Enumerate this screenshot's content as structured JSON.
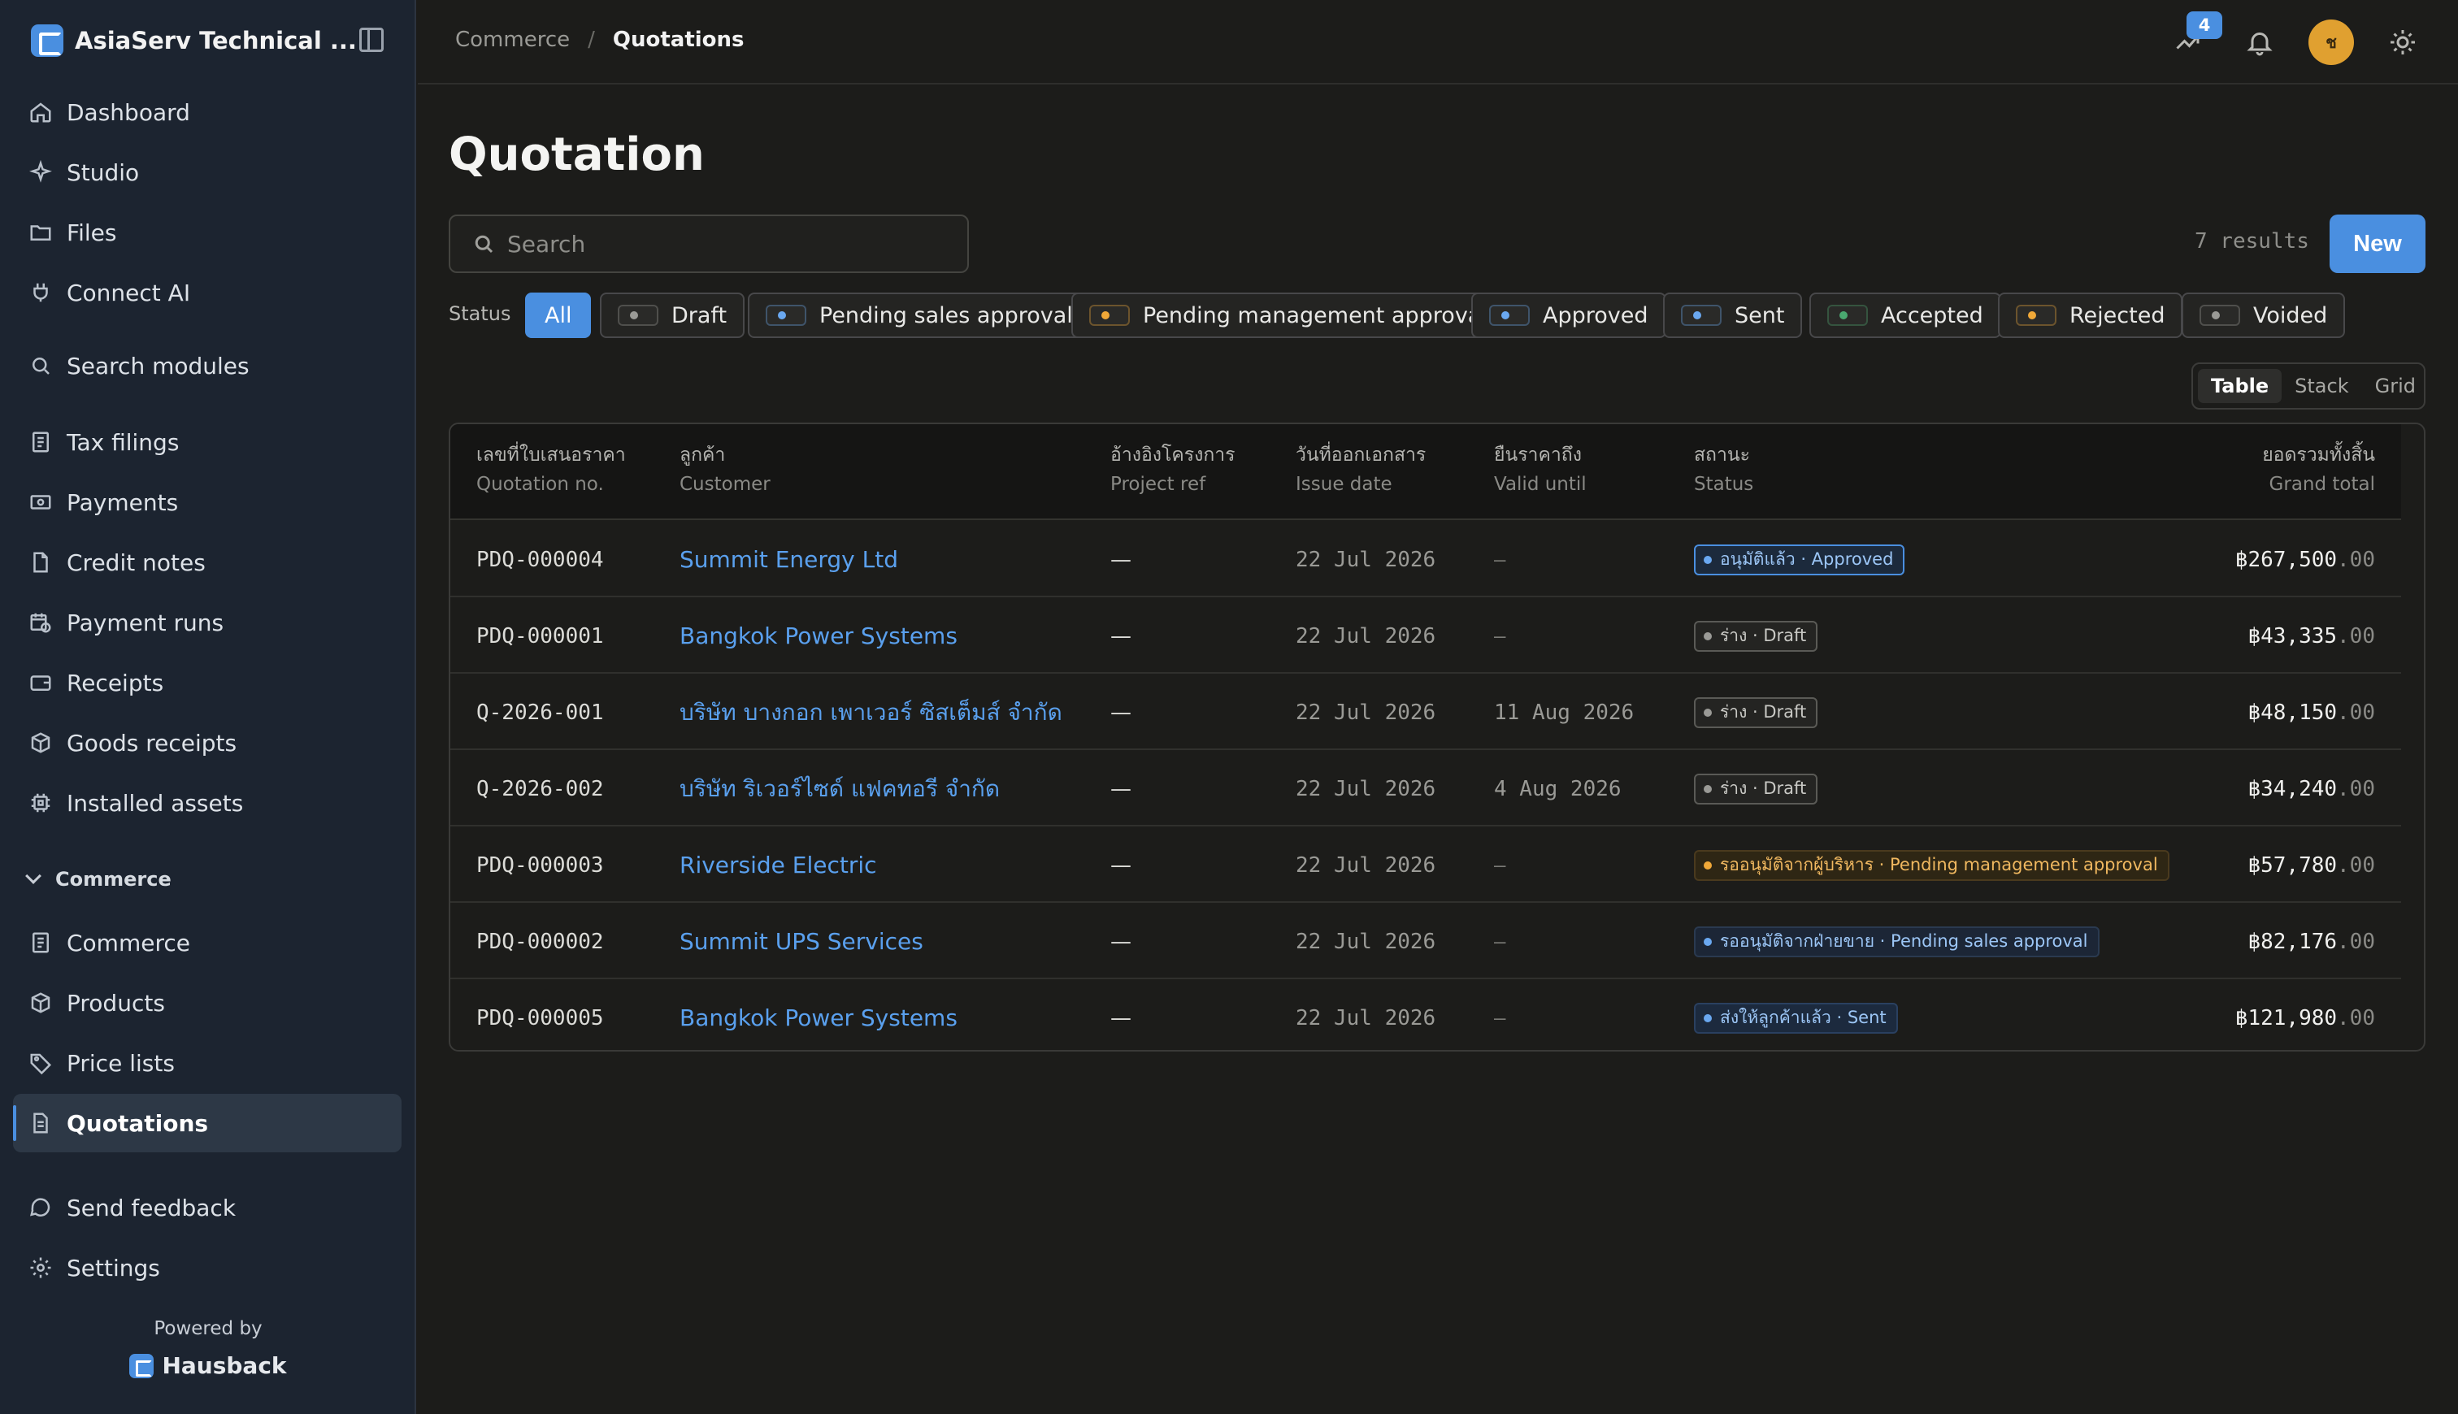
{
  "sidebar": {
    "brand": "AsiaServ Technical ...",
    "items": [
      {
        "label": "Dashboard",
        "icon": "home-icon"
      },
      {
        "label": "Studio",
        "icon": "sparkle-icon"
      },
      {
        "label": "Files",
        "icon": "folder-icon"
      },
      {
        "label": "Connect AI",
        "icon": "plug-icon"
      },
      {
        "label": "Search modules",
        "icon": "search-icon"
      },
      {
        "label": "Tax filings",
        "icon": "tax-icon"
      },
      {
        "label": "Payments",
        "icon": "banknote-icon"
      },
      {
        "label": "Credit notes",
        "icon": "document-icon"
      },
      {
        "label": "Payment runs",
        "icon": "calendar-clock-icon"
      },
      {
        "label": "Receipts",
        "icon": "wallet-icon"
      },
      {
        "label": "Goods receipts",
        "icon": "package-icon"
      },
      {
        "label": "Installed assets",
        "icon": "chip-icon"
      }
    ],
    "section": "Commerce",
    "section_items": [
      {
        "label": "Commerce",
        "icon": "receipt-icon"
      },
      {
        "label": "Products",
        "icon": "box-icon"
      },
      {
        "label": "Price lists",
        "icon": "tag-icon"
      },
      {
        "label": "Quotations",
        "icon": "file-text-icon",
        "active": true
      }
    ],
    "footer_items": [
      {
        "label": "Send feedback",
        "icon": "message-icon"
      },
      {
        "label": "Settings",
        "icon": "gear-icon"
      }
    ],
    "powered_by": "Powered by",
    "powered_brand": "Hausback"
  },
  "topbar": {
    "breadcrumb_parent": "Commerce",
    "breadcrumb_sep": "/",
    "breadcrumb_current": "Quotations",
    "notification_count": "4",
    "avatar_initial": "ช"
  },
  "page": {
    "title": "Quotation",
    "search_placeholder": "Search",
    "results": "7 results",
    "new_label": "New",
    "status_label": "Status"
  },
  "filters": [
    {
      "label": "All"
    },
    {
      "label": "Draft",
      "color": "#9a9a96"
    },
    {
      "label": "Pending sales approval",
      "color": "#6aa8f0"
    },
    {
      "label": "Pending management approval",
      "color": "#f0a838"
    },
    {
      "label": "Approved",
      "color": "#6aa8f0"
    },
    {
      "label": "Sent",
      "color": "#6aa8f0"
    },
    {
      "label": "Accepted",
      "color": "#4aa870"
    },
    {
      "label": "Rejected",
      "color": "#f0a838"
    },
    {
      "label": "Voided",
      "color": "#9a9a96"
    }
  ],
  "views": [
    "Table",
    "Stack",
    "Grid"
  ],
  "columns": [
    {
      "th": "เลขที่ใบเสนอราคา",
      "en": "Quotation no."
    },
    {
      "th": "ลูกค้า",
      "en": "Customer"
    },
    {
      "th": "อ้างอิงโครงการ",
      "en": "Project ref"
    },
    {
      "th": "วันที่ออกเอกสาร",
      "en": "Issue date"
    },
    {
      "th": "ยืนราคาถึง",
      "en": "Valid until"
    },
    {
      "th": "สถานะ",
      "en": "Status"
    },
    {
      "th": "ยอดรวมทั้งสิ้น",
      "en": "Grand total"
    }
  ],
  "rows": [
    {
      "no": "PDQ-000004",
      "customer": "Summit Energy Ltd",
      "project": "—",
      "issue": "22 Jul 2026",
      "valid": "–",
      "status": "อนุมัติแล้ว · Approved",
      "status_kind": "approved",
      "total": "฿267,500",
      "dec": ".00"
    },
    {
      "no": "PDQ-000001",
      "customer": "Bangkok Power Systems",
      "project": "—",
      "issue": "22 Jul 2026",
      "valid": "–",
      "status": "ร่าง · Draft",
      "status_kind": "draft",
      "total": "฿43,335",
      "dec": ".00"
    },
    {
      "no": "Q-2026-001",
      "customer": "บริษัท บางกอก เพาเวอร์ ซิสเต็มส์ จำกัด",
      "project": "—",
      "issue": "22 Jul 2026",
      "valid": "11 Aug 2026",
      "status": "ร่าง · Draft",
      "status_kind": "draft",
      "total": "฿48,150",
      "dec": ".00"
    },
    {
      "no": "Q-2026-002",
      "customer": "บริษัท ริเวอร์ไซด์ แฟคทอรี จำกัด",
      "project": "—",
      "issue": "22 Jul 2026",
      "valid": "4 Aug 2026",
      "status": "ร่าง · Draft",
      "status_kind": "draft",
      "total": "฿34,240",
      "dec": ".00"
    },
    {
      "no": "PDQ-000003",
      "customer": "Riverside Electric",
      "project": "—",
      "issue": "22 Jul 2026",
      "valid": "–",
      "status": "รออนุมัติจากผู้บริหาร · Pending management approval",
      "status_kind": "mgmt",
      "total": "฿57,780",
      "dec": ".00"
    },
    {
      "no": "PDQ-000002",
      "customer": "Summit UPS Services",
      "project": "—",
      "issue": "22 Jul 2026",
      "valid": "–",
      "status": "รออนุมัติจากฝ่ายขาย · Pending sales approval",
      "status_kind": "sales",
      "total": "฿82,176",
      "dec": ".00"
    },
    {
      "no": "PDQ-000005",
      "customer": "Bangkok Power Systems",
      "project": "—",
      "issue": "22 Jul 2026",
      "valid": "–",
      "status": "ส่งให้ลูกค้าแล้ว · Sent",
      "status_kind": "sent",
      "total": "฿121,980",
      "dec": ".00"
    }
  ]
}
